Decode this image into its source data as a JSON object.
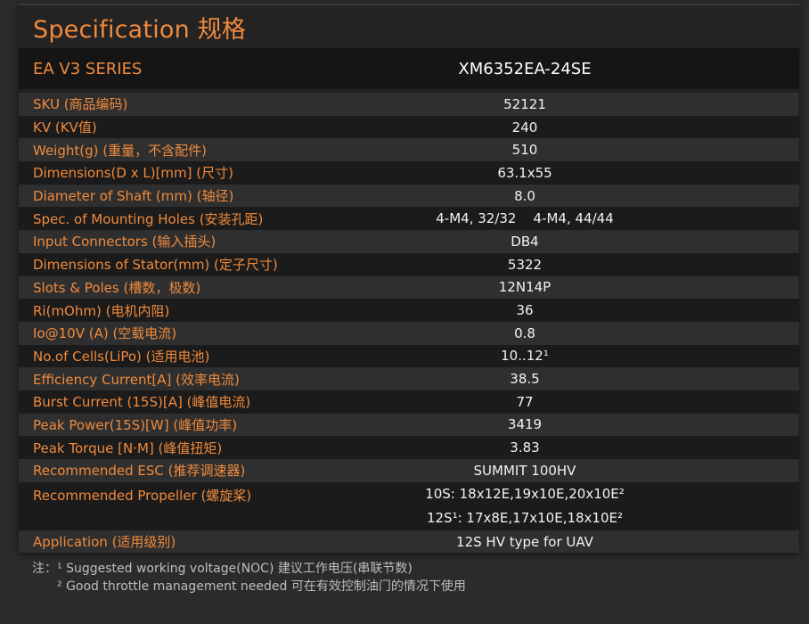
{
  "title": "Specification 规格",
  "series": {
    "label": "EA V3 SERIES",
    "model": "XM6352EA-24SE"
  },
  "specs": [
    {
      "label": "SKU (商品编码)",
      "value": "52121"
    },
    {
      "label": "KV (KV值)",
      "value": "240"
    },
    {
      "label": "Weight(g) (重量，不含配件)",
      "value": "510"
    },
    {
      "label": "Dimensions(D x L)[mm] (尺寸)",
      "value": "63.1x55"
    },
    {
      "label": "Diameter of Shaft (mm) (轴径)",
      "value": "8.0"
    },
    {
      "label": "Spec. of Mounting Holes (安装孔距)",
      "value": "4-M4, 32/32    4-M4, 44/44"
    },
    {
      "label": "Input Connectors (输入插头)",
      "value": "DB4"
    },
    {
      "label": "Dimensions of Stator(mm) (定子尺寸)",
      "value": "5322"
    },
    {
      "label": "Slots & Poles (槽数，极数)",
      "value": "12N14P"
    },
    {
      "label": "Ri(mOhm) (电机内阻)",
      "value": "36"
    },
    {
      "label": "Io@10V (A) (空载电流)",
      "value": "0.8"
    },
    {
      "label": "No.of Cells(LiPo) (适用电池)",
      "value": "10..12¹"
    },
    {
      "label": "Efficiency Current[A] (效率电流)",
      "value": "38.5"
    },
    {
      "label": "Burst Current (15S)[A] (峰值电流)",
      "value": "77"
    },
    {
      "label": "Peak Power(15S)[W] (峰值功率)",
      "value": "3419"
    },
    {
      "label": "Peak Torque [N·M] (峰值扭矩)",
      "value": "3.83"
    },
    {
      "label": "Recommended ESC (推荐调速器)",
      "value": "SUMMIT 100HV"
    }
  ],
  "propeller": {
    "label": "Recommended Propeller (螺旋桨)",
    "value_10s": "10S: 18x12E,19x10E,20x10E²",
    "value_12s": "12S¹: 17x8E,17x10E,18x10E²"
  },
  "application": {
    "label": "Application (适用级别)",
    "value": "12S HV type for UAV"
  },
  "notes": {
    "prefix": "注：",
    "note1": "¹ Suggested working voltage(NOC) 建议工作电压(串联节数)",
    "note2": "² Good throttle management needed 可在有效控制油门的情况下使用"
  }
}
